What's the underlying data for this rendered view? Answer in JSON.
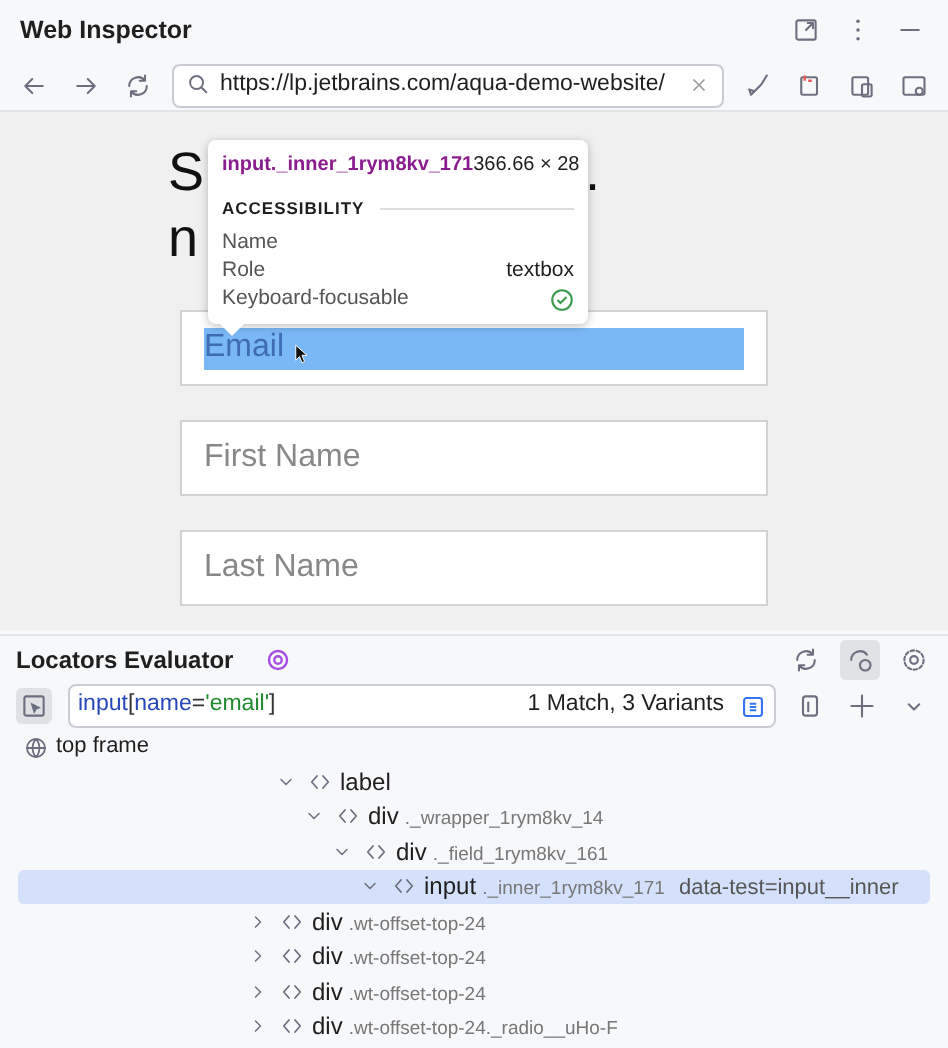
{
  "window": {
    "title": "Web Inspector"
  },
  "toolbar": {
    "url": "https://lp.jetbrains.com/aqua-demo-website/"
  },
  "page": {
    "heading_lines": [
      [
        "S",
        "."
      ],
      [
        "n"
      ]
    ],
    "fields": [
      {
        "placeholder": "Email",
        "highlighted": true
      },
      {
        "placeholder": "First Name",
        "highlighted": false
      },
      {
        "placeholder": "Last Name",
        "highlighted": false
      }
    ],
    "tooltip": {
      "element": "input._inner_1rym8kv_171",
      "size": "366.66 × 28",
      "section": "ACCESSIBILITY",
      "rows": [
        {
          "label": "Name"
        },
        {
          "label": "Role",
          "value": "textbox"
        },
        {
          "label": "Keyboard-focusable",
          "check": true
        }
      ]
    }
  },
  "evaluator": {
    "title": "Locators Evaluator",
    "locator_parts": [
      {
        "text": "input",
        "kind": "tag"
      },
      {
        "text": "[",
        "kind": "punct"
      },
      {
        "text": "name",
        "kind": "tag"
      },
      {
        "text": "=",
        "kind": "punct"
      },
      {
        "text": "'email'",
        "kind": "string"
      },
      {
        "text": "]",
        "kind": "punct"
      }
    ],
    "matches": "1 Match, 3 Variants",
    "frame": "top frame",
    "tree": [
      {
        "children": [
          {
            "tag": "label",
            "expanded": true,
            "selected": false,
            "children": [
              {
                "tag": "div",
                "classes": "._wrapper_1rym8kv_14",
                "expanded": true,
                "selected": false,
                "children": [
                  {
                    "tag": "div",
                    "classes": "._field_1rym8kv_161",
                    "expanded": true,
                    "selected": false,
                    "children": [
                      {
                        "tag": "input",
                        "classes": "._inner_1rym8kv_171",
                        "attribute": "data-test=input__inner",
                        "expanded": true,
                        "selected": true
                      }
                    ]
                  }
                ]
              }
            ]
          }
        ]
      },
      {
        "tag": "div",
        "classes": ".wt-offset-top-24",
        "expanded": false,
        "selected": false
      },
      {
        "tag": "div",
        "classes": ".wt-offset-top-24",
        "expanded": false,
        "selected": false
      },
      {
        "tag": "div",
        "classes": ".wt-offset-top-24",
        "expanded": false,
        "selected": false
      },
      {
        "tag": "div",
        "classes": ".wt-offset-top-24._radio__uHo-F",
        "expanded": false,
        "selected": false
      }
    ]
  }
}
